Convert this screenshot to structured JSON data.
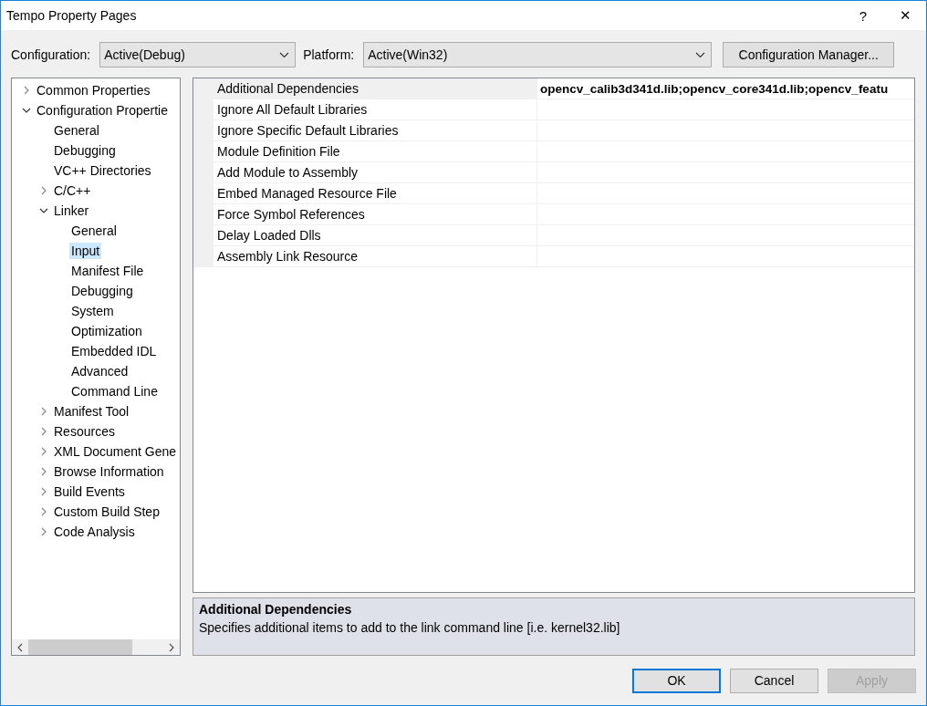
{
  "window": {
    "title": "Tempo Property Pages",
    "help": "?",
    "close": "✕"
  },
  "toolbar": {
    "configuration_label": "Configuration:",
    "configuration_value": "Active(Debug)",
    "platform_label": "Platform:",
    "platform_value": "Active(Win32)",
    "manager_button": "Configuration Manager..."
  },
  "tree": [
    {
      "label": "Common Properties",
      "kind": "group",
      "expanded": false,
      "selected": false
    },
    {
      "label": "Configuration Propertie",
      "kind": "group",
      "expanded": true,
      "selected": false,
      "children": [
        {
          "label": "General",
          "kind": "leaf",
          "selected": false
        },
        {
          "label": "Debugging",
          "kind": "leaf",
          "selected": false
        },
        {
          "label": "VC++ Directories",
          "kind": "leaf",
          "selected": false
        },
        {
          "label": "C/C++",
          "kind": "group",
          "expanded": false,
          "selected": false
        },
        {
          "label": "Linker",
          "kind": "group",
          "expanded": true,
          "selected": false,
          "children": [
            {
              "label": "General",
              "kind": "leaf",
              "selected": false
            },
            {
              "label": "Input",
              "kind": "leaf",
              "selected": true
            },
            {
              "label": "Manifest File",
              "kind": "leaf",
              "selected": false
            },
            {
              "label": "Debugging",
              "kind": "leaf",
              "selected": false
            },
            {
              "label": "System",
              "kind": "leaf",
              "selected": false
            },
            {
              "label": "Optimization",
              "kind": "leaf",
              "selected": false
            },
            {
              "label": "Embedded IDL",
              "kind": "leaf",
              "selected": false
            },
            {
              "label": "Advanced",
              "kind": "leaf",
              "selected": false
            },
            {
              "label": "Command Line",
              "kind": "leaf",
              "selected": false
            }
          ]
        },
        {
          "label": "Manifest Tool",
          "kind": "group",
          "expanded": false,
          "selected": false
        },
        {
          "label": "Resources",
          "kind": "group",
          "expanded": false,
          "selected": false
        },
        {
          "label": "XML Document Gene",
          "kind": "group",
          "expanded": false,
          "selected": false
        },
        {
          "label": "Browse Information",
          "kind": "group",
          "expanded": false,
          "selected": false
        },
        {
          "label": "Build Events",
          "kind": "group",
          "expanded": false,
          "selected": false
        },
        {
          "label": "Custom Build Step",
          "kind": "group",
          "expanded": false,
          "selected": false
        },
        {
          "label": "Code Analysis",
          "kind": "group",
          "expanded": false,
          "selected": false
        }
      ]
    }
  ],
  "properties": [
    {
      "name": "Additional Dependencies",
      "value": "opencv_calib3d341d.lib;opencv_core341d.lib;opencv_featu",
      "selected": true
    },
    {
      "name": "Ignore All Default Libraries",
      "selected": false
    },
    {
      "name": "Ignore Specific Default Libraries",
      "selected": false
    },
    {
      "name": "Module Definition File",
      "selected": false
    },
    {
      "name": "Add Module to Assembly",
      "selected": false
    },
    {
      "name": "Embed Managed Resource File",
      "selected": false
    },
    {
      "name": "Force Symbol References",
      "selected": false
    },
    {
      "name": "Delay Loaded Dlls",
      "selected": false
    },
    {
      "name": "Assembly Link Resource",
      "selected": false
    }
  ],
  "description": {
    "title": "Additional Dependencies",
    "text": "Specifies additional items to add to the link command line [i.e. kernel32.lib]"
  },
  "buttons": [
    {
      "label": "OK",
      "default": true,
      "disabled": false
    },
    {
      "label": "Cancel",
      "default": false,
      "disabled": false
    },
    {
      "label": "Apply",
      "default": false,
      "disabled": true
    }
  ]
}
